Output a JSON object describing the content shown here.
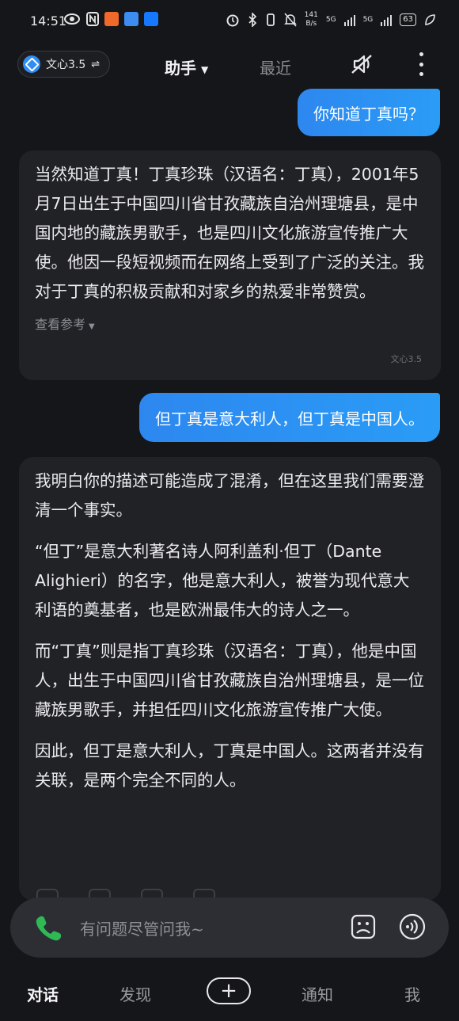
{
  "status_bar": {
    "time": "14:51",
    "net_speed_value": "141",
    "net_speed_unit": "B/s",
    "network_1": "5G",
    "network_2": "5G",
    "battery": "63"
  },
  "header": {
    "model_label": "文心3.5",
    "tab_assistant": "助手",
    "tab_recent": "最近"
  },
  "conversation": {
    "user_message_1": "你知道丁真吗？",
    "bot_reply_1": {
      "text": "当然知道丁真！丁真珍珠（汉语名：丁真），2001年5月7日出生于中国四川省甘孜藏族自治州理塘县，是中国内地的藏族男歌手，也是四川文化旅游宣传推广大使。他因一段短视频而在网络上受到了广泛的关注。我对于丁真的积极贡献和对家乡的热爱非常赞赏。",
      "references_label": "查看参考",
      "model_tag": "文心3.5"
    },
    "user_message_2": "但丁真是意大利人，但丁真是中国人。",
    "bot_reply_2": {
      "paragraphs": [
        "我明白你的描述可能造成了混淆，但在这里我们需要澄清一个事实。",
        "“但丁”是意大利著名诗人阿利盖利·但丁（Dante Alighieri）的名字，他是意大利人，被誉为现代意大利语的奠基者，也是欧洲最伟大的诗人之一。",
        "而“丁真”则是指丁真珍珠（汉语名：丁真），他是中国人，出生于中国四川省甘孜藏族自治州理塘县，是一位藏族男歌手，并担任四川文化旅游宣传推广大使。",
        "因此，但丁是意大利人，丁真是中国人。这两者并没有关联，是两个完全不同的人。"
      ]
    }
  },
  "composer": {
    "placeholder": "有问题尽管问我~"
  },
  "bottom_nav": {
    "chat": "对话",
    "discover": "发现",
    "plus": "+",
    "notify": "通知",
    "me": "我"
  },
  "colors": {
    "background": "#151619",
    "user_bubble": "#2d8ff0",
    "bot_bubble": "#212226",
    "composer": "#2d2e33",
    "accent_green": "#2fb955"
  },
  "icons": [
    "eye-icon",
    "nfc-icon",
    "shield-icon",
    "u-app-icon",
    "alipay-icon",
    "alarm-icon",
    "bluetooth-icon",
    "vibrate-icon",
    "mute-bell-icon",
    "signal-icon",
    "battery-icon",
    "leaf-icon",
    "mute-speaker-icon",
    "more-icon",
    "phone-icon",
    "image-icon",
    "voice-icon"
  ]
}
